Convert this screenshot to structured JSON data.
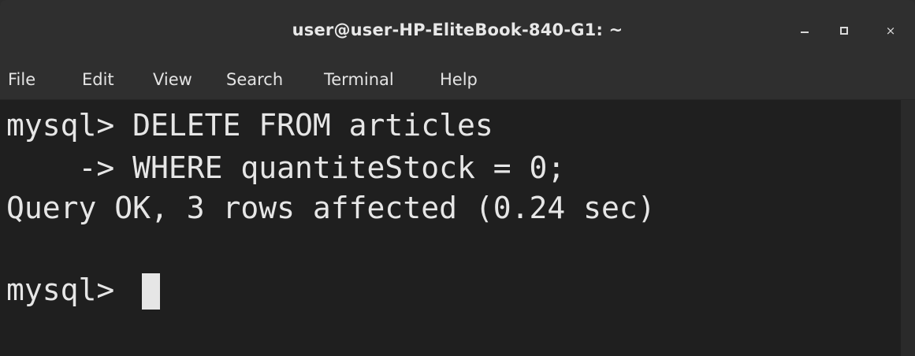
{
  "window": {
    "title": "user@user-HP-EliteBook-840-G1: ~",
    "controls": {
      "minimize": "minimize",
      "maximize": "maximize",
      "close": "×"
    }
  },
  "menu": {
    "items": [
      "File",
      "Edit",
      "View",
      "Search",
      "Terminal",
      "Help"
    ]
  },
  "terminal": {
    "lines": [
      "mysql> DELETE FROM articles",
      "    -> WHERE quantiteStock = 0;",
      "Query OK, 3 rows affected (0.24 sec)",
      "",
      "mysql> "
    ],
    "colors": {
      "background": "#1f1f1f",
      "foreground": "#e6e6e6",
      "titlebar": "#2f2f2f"
    }
  }
}
